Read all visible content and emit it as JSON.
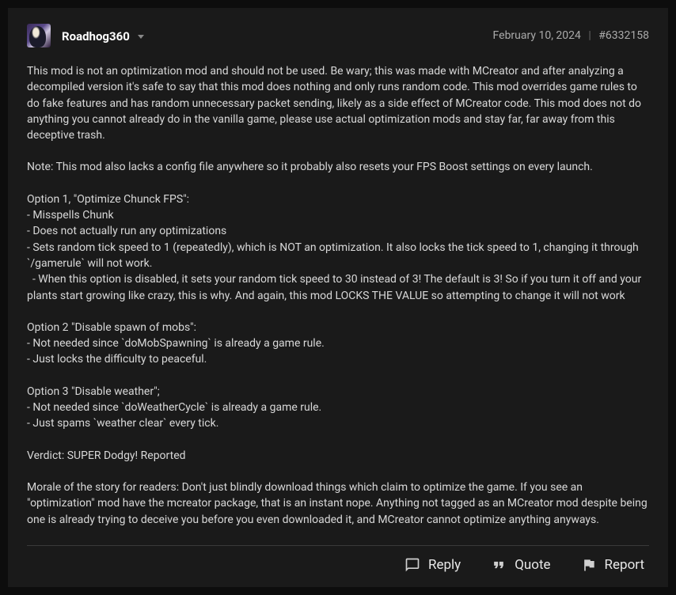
{
  "author": {
    "name": "Roadhog360"
  },
  "meta": {
    "date": "February 10, 2024",
    "post_id": "#6332158"
  },
  "body": {
    "intro": "This mod is not an optimization mod and should not be used. Be wary; this was made with MCreator and after analyzing a decompiled version it's safe to say that this mod does nothing and only runs random code. This mod overrides game rules to do fake features and has random unnecessary packet sending, likely as a side effect of MCreator code. This mod does not do anything you cannot already do in the vanilla game, please use actual optimization mods and stay far, far away from this deceptive trash.",
    "note": "Note: This mod also lacks a config file anywhere so it probably also resets your FPS Boost settings on every launch.",
    "opt1_title": "Option 1, \"Optimize Chunck FPS\":",
    "opt1_l1": "- Misspells Chunk",
    "opt1_l2": "- Does not actually run any optimizations",
    "opt1_l3": "- Sets random tick speed to 1 (repeatedly), which is NOT an optimization. It also locks the tick speed to 1, changing it through `/gamerule` will not work.",
    "opt1_l4": "  - When this option is disabled, it sets your random tick speed to 30 instead of 3! The default is 3! So if you turn it off and your plants start growing like crazy, this is why. And again, this mod LOCKS THE VALUE so attempting to change it will not work",
    "opt2_title": "Option 2 \"Disable spawn of mobs\":",
    "opt2_l1": "- Not needed since `doMobSpawning` is already a game rule.",
    "opt2_l2": "- Just locks the difficulty to peaceful.",
    "opt3_title": "Option 3 \"Disable weather\";",
    "opt3_l1": "- Not needed since `doWeatherCycle` is already a game rule.",
    "opt3_l2": "- Just spams `weather clear` every tick.",
    "verdict": "Verdict: SUPER Dodgy! Reported",
    "morale": "Morale of the story for readers: Don't just blindly download things which claim to optimize the game. If you see an \"optimization\" mod have the mcreator package, that is an instant nope. Anything not tagged as an MCreator mod despite being one is already trying to deceive you before you even downloaded it, and MCreator cannot optimize anything anyways."
  },
  "actions": {
    "reply": "Reply",
    "quote": "Quote",
    "report": "Report"
  }
}
